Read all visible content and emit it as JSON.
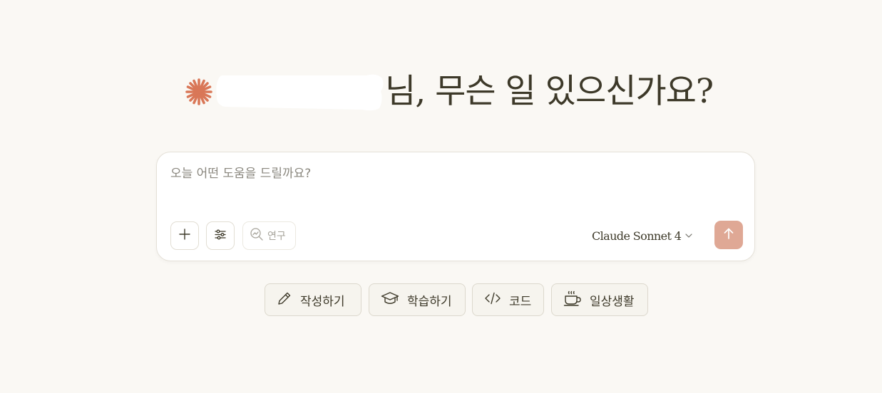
{
  "greeting": {
    "text": "님, 무슨 일 있으신가요?"
  },
  "composer": {
    "placeholder": "오늘 어떤 도움을 드릴까요?",
    "research_label": "연구",
    "model_name": "Claude Sonnet 4"
  },
  "chips": [
    {
      "label": "작성하기",
      "icon": "pencil-icon"
    },
    {
      "label": "학습하기",
      "icon": "graduation-cap-icon"
    },
    {
      "label": "코드",
      "icon": "code-icon"
    },
    {
      "label": "일상생활",
      "icon": "coffee-cup-icon"
    }
  ],
  "colors": {
    "background": "#faf8f4",
    "accent": "#d97757",
    "send_button": "#dfa895",
    "text": "#3d3929"
  }
}
